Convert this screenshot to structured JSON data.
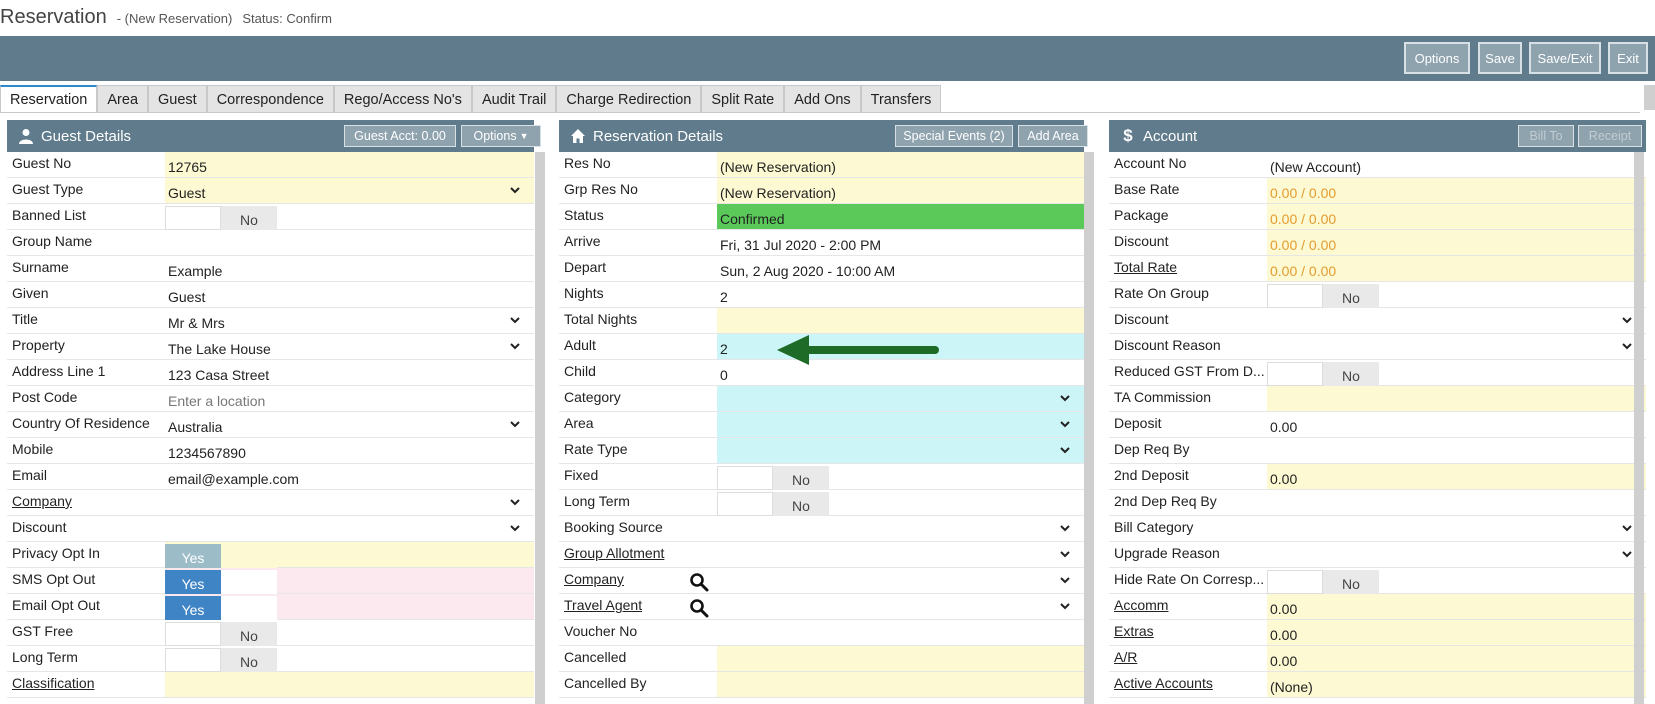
{
  "title": {
    "main": "Reservation",
    "sub": "- (New Reservation)",
    "status": "Status: Confirm"
  },
  "toolbar": {
    "options": "Options",
    "save": "Save",
    "save_exit": "Save/Exit",
    "exit": "Exit"
  },
  "tabs": [
    "Reservation",
    "Area",
    "Guest",
    "Correspondence",
    "Rego/Access No's",
    "Audit Trail",
    "Charge Redirection",
    "Split Rate",
    "Add Ons",
    "Transfers"
  ],
  "guest_panel": {
    "title": "Guest Details",
    "guest_acct_btn": "Guest Acct: 0.00",
    "options_btn": "Options",
    "rows": [
      {
        "label": "Guest No",
        "value": "12765"
      },
      {
        "label": "Guest Type",
        "value": "Guest"
      },
      {
        "label": "Banned List",
        "value": "No"
      },
      {
        "label": "Group Name",
        "value": ""
      },
      {
        "label": "Surname",
        "value": "Example"
      },
      {
        "label": "Given",
        "value": "Guest"
      },
      {
        "label": "Title",
        "value": "Mr & Mrs"
      },
      {
        "label": "Property",
        "value": "The Lake House"
      },
      {
        "label": "Address Line 1",
        "value": "123 Casa Street"
      },
      {
        "label": "Post Code",
        "value": "Enter a location"
      },
      {
        "label": "Country Of Residence",
        "value": "Australia"
      },
      {
        "label": "Mobile",
        "value": "1234567890"
      },
      {
        "label": "Email",
        "value": "email@example.com"
      },
      {
        "label": "Company",
        "value": ""
      },
      {
        "label": "Discount",
        "value": ""
      },
      {
        "label": "Privacy Opt In",
        "value": "Yes"
      },
      {
        "label": "SMS Opt Out",
        "value": "Yes"
      },
      {
        "label": "Email Opt Out",
        "value": "Yes"
      },
      {
        "label": "GST Free",
        "value": "No"
      },
      {
        "label": "Long Term",
        "value": "No"
      },
      {
        "label": "Classification",
        "value": ""
      }
    ]
  },
  "res_panel": {
    "title": "Reservation Details",
    "special_btn": "Special Events (2)",
    "add_area_btn": "Add Area",
    "rows": [
      {
        "label": "Res No",
        "value": "(New Reservation)"
      },
      {
        "label": "Grp Res No",
        "value": "(New Reservation)"
      },
      {
        "label": "Status",
        "value": "Confirmed"
      },
      {
        "label": "Arrive",
        "value": "Fri, 31 Jul 2020 - 2:00 PM"
      },
      {
        "label": "Depart",
        "value": "Sun, 2 Aug 2020 - 10:00 AM"
      },
      {
        "label": "Nights",
        "value": "2"
      },
      {
        "label": "Total Nights",
        "value": ""
      },
      {
        "label": "Adult",
        "value": "2"
      },
      {
        "label": "Child",
        "value": "0"
      },
      {
        "label": "Category",
        "value": ""
      },
      {
        "label": "Area",
        "value": ""
      },
      {
        "label": "Rate Type",
        "value": ""
      },
      {
        "label": "Fixed",
        "value": "No"
      },
      {
        "label": "Long Term",
        "value": "No"
      },
      {
        "label": "Booking Source",
        "value": ""
      },
      {
        "label": "Group Allotment",
        "value": ""
      },
      {
        "label": "Company",
        "value": ""
      },
      {
        "label": "Travel Agent",
        "value": ""
      },
      {
        "label": "Voucher No",
        "value": ""
      },
      {
        "label": "Cancelled",
        "value": ""
      },
      {
        "label": "Cancelled By",
        "value": ""
      }
    ]
  },
  "acct_panel": {
    "title": "Account",
    "bill_to_btn": "Bill To",
    "receipt_btn": "Receipt",
    "rows": [
      {
        "label": "Account No",
        "value": "(New Account)"
      },
      {
        "label": "Base Rate",
        "value": "0.00 / 0.00"
      },
      {
        "label": "Package",
        "value": "0.00 / 0.00"
      },
      {
        "label": "Discount",
        "value": "0.00 / 0.00"
      },
      {
        "label": "Total Rate",
        "value": "0.00 / 0.00"
      },
      {
        "label": "Rate On Group",
        "value": "No"
      },
      {
        "label": "Discount",
        "value": ""
      },
      {
        "label": "Discount Reason",
        "value": ""
      },
      {
        "label": "Reduced GST From D...",
        "value": "No"
      },
      {
        "label": "TA Commission",
        "value": ""
      },
      {
        "label": "Deposit",
        "value": "0.00"
      },
      {
        "label": "Dep Req By",
        "value": ""
      },
      {
        "label": "2nd Deposit",
        "value": "0.00"
      },
      {
        "label": "2nd Dep Req By",
        "value": ""
      },
      {
        "label": "Bill Category",
        "value": ""
      },
      {
        "label": "Upgrade Reason",
        "value": ""
      },
      {
        "label": "Hide Rate On Corresp...",
        "value": "No"
      },
      {
        "label": "Accomm",
        "value": "0.00"
      },
      {
        "label": "Extras",
        "value": "0.00"
      },
      {
        "label": "A/R",
        "value": "0.00"
      },
      {
        "label": "Active Accounts",
        "value": "(None)"
      }
    ]
  },
  "colors": {
    "header": "#5f7b8c",
    "yellow_field": "#fdf9d2",
    "blue_field": "#cbf5f7",
    "green_status": "#5ac95a",
    "arrow": "#1e6b27"
  },
  "icons": {
    "guest": "person-icon",
    "res": "home-icon",
    "acct": "dollar-icon"
  }
}
